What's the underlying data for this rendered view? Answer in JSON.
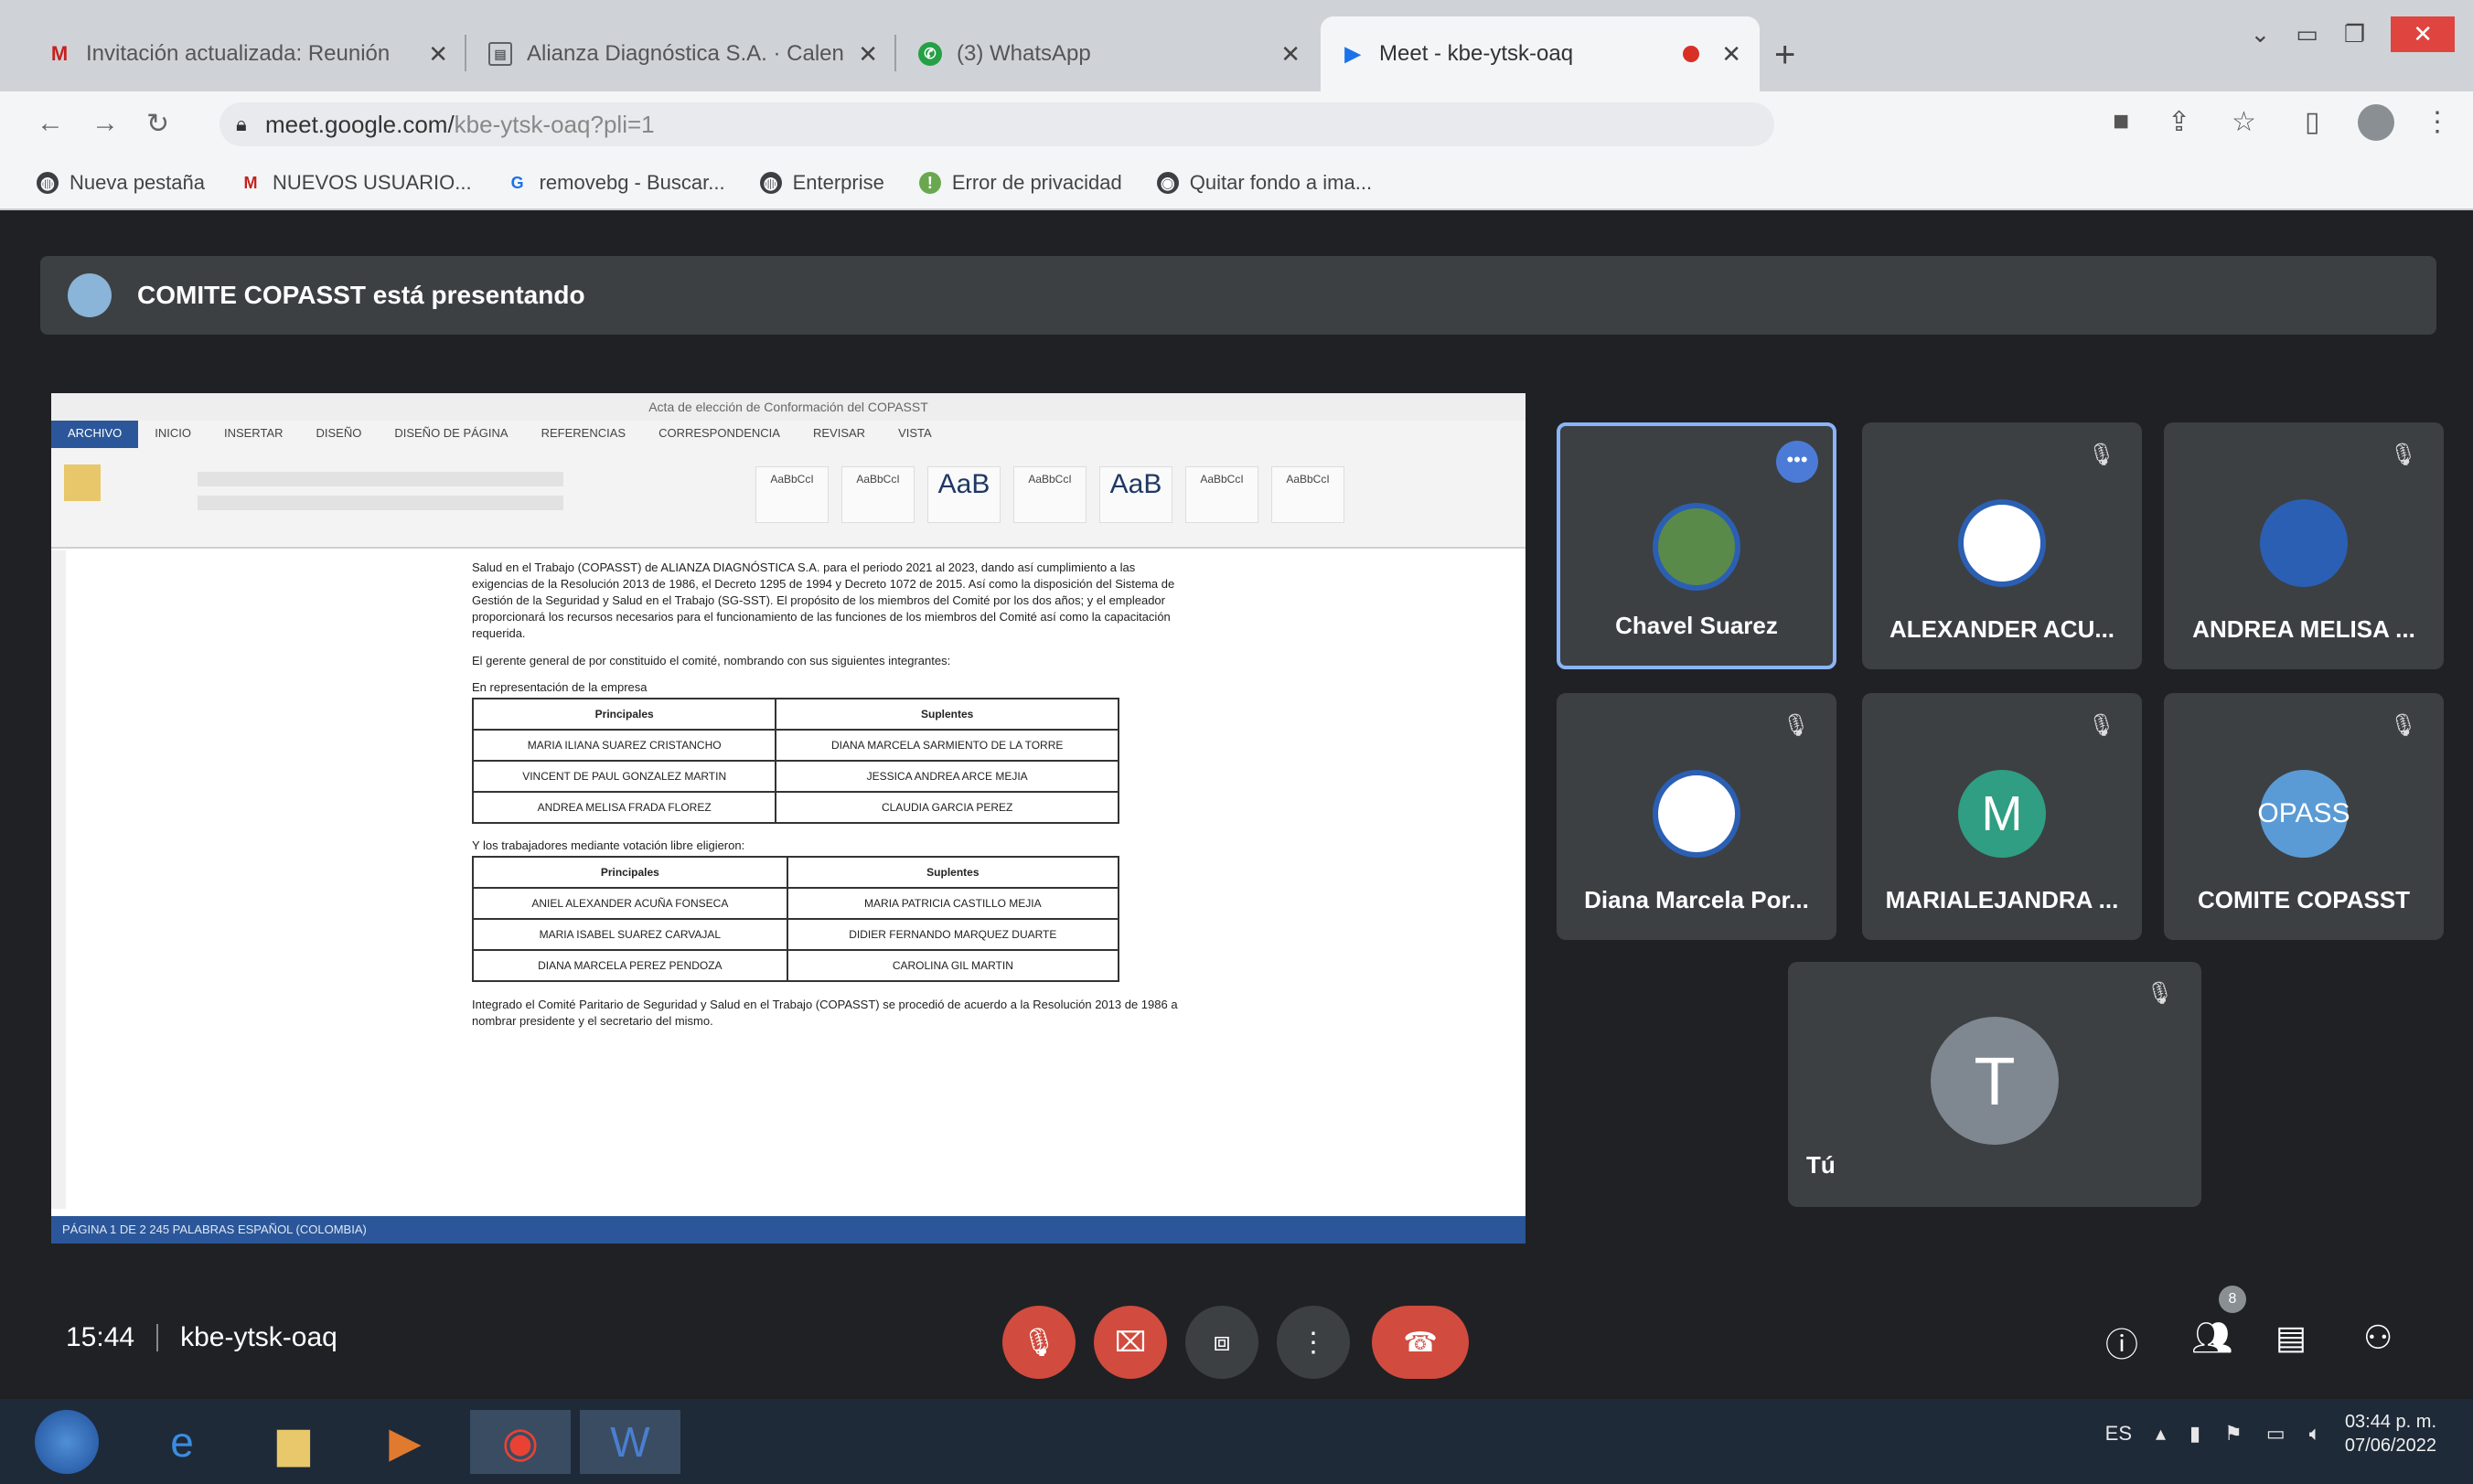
{
  "browser": {
    "tabs": [
      {
        "icon": "gmail-icon",
        "title": "Invitación actualizada: Reunión"
      },
      {
        "icon": "doc-icon",
        "title": "Alianza Diagnóstica S.A. · Calen"
      },
      {
        "icon": "whatsapp-icon",
        "title": "(3) WhatsApp"
      },
      {
        "icon": "meet-icon",
        "title": "Meet - kbe-ytsk-oaq"
      }
    ],
    "new_tab": "+",
    "url_domain": "meet.google.com/",
    "url_rest": "kbe-ytsk-oaq?pli=1",
    "bookmarks": [
      {
        "icon": "globe-icon",
        "label": "Nueva pestaña"
      },
      {
        "icon": "gmail-icon",
        "label": "NUEVOS USUARIO..."
      },
      {
        "icon": "search-icon",
        "label": "removebg - Buscar..."
      },
      {
        "icon": "globe-icon",
        "label": "Enterprise"
      },
      {
        "icon": "warning-icon",
        "label": "Error de privacidad"
      },
      {
        "icon": "eye-icon",
        "label": "Quitar fondo a ima..."
      }
    ]
  },
  "meet": {
    "presenting_text": "COMITE COPASST está presentando",
    "shared_screen": {
      "ribbon_tabs": [
        "ARCHIVO",
        "INICIO",
        "INSERTAR",
        "DISEÑO",
        "DISEÑO DE PÁGINA",
        "REFERENCIAS",
        "CORRESPONDENCIA",
        "REVISAR",
        "VISTA"
      ],
      "style_samples": [
        "AaBbCcI",
        "AaBbCcI",
        "AaB",
        "AaBbCcI",
        "AaB",
        "AaBbCcI",
        "AaBbCcI"
      ],
      "doc_title": "Acta de elección de Conformación del COPASST",
      "paragraph1": "Salud en el Trabajo (COPASST) de ALIANZA DIAGNÓSTICA S.A. para el periodo 2021 al 2023, dando así cumplimiento a las exigencias de la Resolución 2013 de 1986, el Decreto 1295 de 1994 y Decreto 1072 de 2015. Así como la disposición del Sistema de Gestión de la Seguridad y Salud en el Trabajo (SG-SST). El propósito de los miembros del Comité por los dos años; y el empleador proporcionará los recursos necesarios para el funcionamiento de las funciones de los miembros del Comité así como la capacitación requerida.",
      "paragraph2": "El gerente general de por constituido el comité, nombrando con sus siguientes integrantes:",
      "label_company": "En representación de la empresa",
      "table1_headers": [
        "Principales",
        "Suplentes"
      ],
      "table1_rows": [
        [
          "MARIA ILIANA SUAREZ CRISTANCHO",
          "DIANA MARCELA SARMIENTO DE LA TORRE"
        ],
        [
          "VINCENT DE PAUL GONZALEZ MARTIN",
          "JESSICA ANDREA ARCE MEJIA"
        ],
        [
          "ANDREA MELISA FRADA FLOREZ",
          "CLAUDIA GARCIA PEREZ"
        ]
      ],
      "label_workers": "Y los trabajadores mediante votación libre eligieron:",
      "table2_headers": [
        "Principales",
        "Suplentes"
      ],
      "table2_rows": [
        [
          "ANIEL ALEXANDER ACUÑA FONSECA",
          "MARIA PATRICIA CASTILLO MEJIA"
        ],
        [
          "MARIA ISABEL SUAREZ CARVAJAL",
          "DIDIER FERNANDO MARQUEZ DUARTE"
        ],
        [
          "DIANA MARCELA PEREZ PENDOZA",
          "CAROLINA GIL MARTIN"
        ]
      ],
      "paragraph3": "Integrado el Comité Paritario de Seguridad y Salud en el Trabajo (COPASST) se procedió de acuerdo a la Resolución 2013 de 1986 a nombrar presidente y el secretario del mismo.",
      "status_text": "PÁGINA 1 DE 2    245 PALABRAS    ESPAÑOL (COLOMBIA)"
    },
    "participants": [
      {
        "name": "Chavel Suarez",
        "initial": "",
        "avatar_color": "#5a8a4a",
        "active": true
      },
      {
        "name": "ALEXANDER ACU...",
        "initial": "",
        "avatar_color": "#ffffff",
        "active": false
      },
      {
        "name": "ANDREA MELISA ...",
        "initial": "",
        "avatar_color": "#2b5fb3",
        "active": false
      },
      {
        "name": "Diana Marcela Por...",
        "initial": "",
        "avatar_color": "#ffffff",
        "active": false
      },
      {
        "name": "MARIALEJANDRA ...",
        "initial": "M",
        "avatar_color": "#2f9e83",
        "active": false
      },
      {
        "name": "COMITE COPASST",
        "initial": "OPASS",
        "avatar_color": "#5b9bd5",
        "active": false
      }
    ],
    "self": {
      "name": "Tú",
      "initial": "T"
    },
    "time": "15:44",
    "meeting_code": "kbe-ytsk-oaq",
    "participant_count": "8"
  },
  "taskbar": {
    "lang": "ES",
    "clock_time": "03:44 p. m.",
    "clock_date": "07/06/2022"
  }
}
